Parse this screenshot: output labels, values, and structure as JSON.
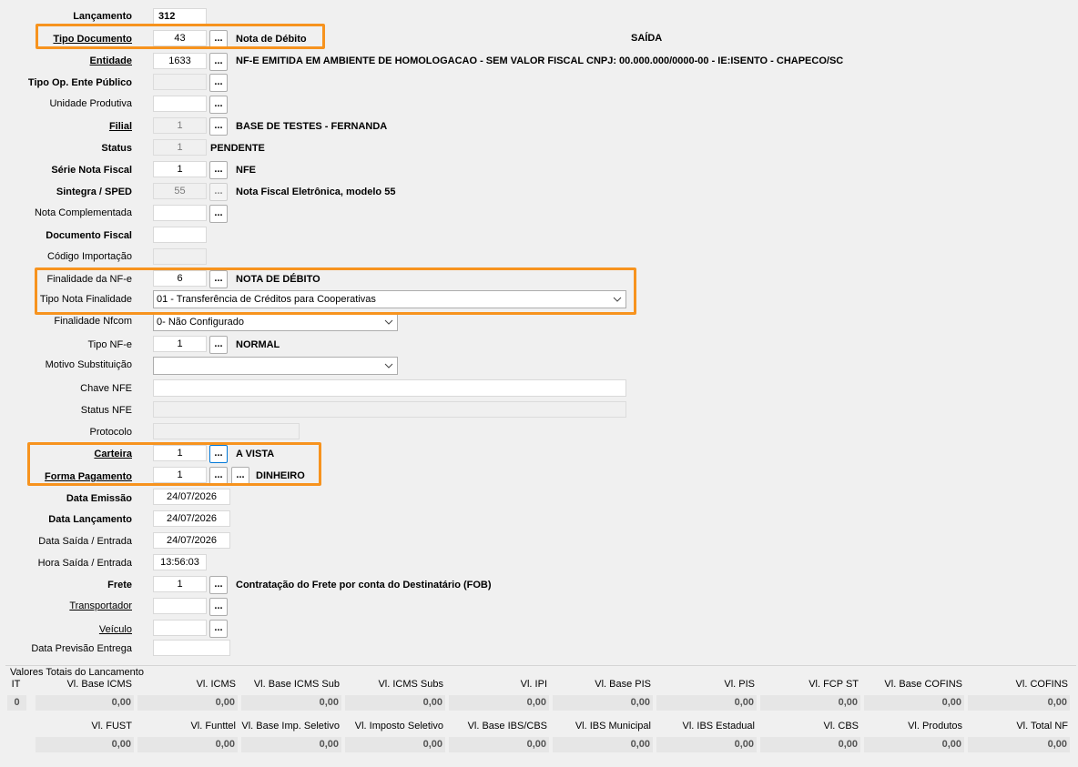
{
  "form": {
    "lancamento": {
      "label": "Lançamento",
      "value": "312"
    },
    "tipo_documento": {
      "label": "Tipo Documento",
      "value": "43",
      "desc": "Nota de Débito",
      "operacao": "SAÍDA"
    },
    "entidade": {
      "label": "Entidade",
      "value": "1633",
      "desc": "NF-E EMITIDA EM AMBIENTE DE HOMOLOGACAO - SEM VALOR FISCAL CNPJ: 00.000.000/0000-00 - IE:ISENTO - CHAPECO/SC"
    },
    "tipo_op_ente": {
      "label": "Tipo Op. Ente Público",
      "value": ""
    },
    "unidade_produtiva": {
      "label": "Unidade Produtiva",
      "value": ""
    },
    "filial": {
      "label": "Filial",
      "value": "1",
      "desc": "BASE DE TESTES - FERNANDA"
    },
    "status": {
      "label": "Status",
      "value": "1",
      "desc": "PENDENTE"
    },
    "serie": {
      "label": "Série Nota Fiscal",
      "value": "1",
      "desc": "NFE"
    },
    "sintegra": {
      "label": "Sintegra / SPED",
      "value": "55",
      "desc": "Nota Fiscal Eletrônica, modelo 55"
    },
    "nota_complementada": {
      "label": "Nota Complementada",
      "value": ""
    },
    "documento_fiscal": {
      "label": "Documento Fiscal",
      "value": ""
    },
    "codigo_importacao": {
      "label": "Código Importação",
      "value": ""
    },
    "finalidade_nfe": {
      "label": "Finalidade da NF-e",
      "value": "6",
      "desc": "NOTA DE DÉBITO"
    },
    "tipo_nota_finalidade": {
      "label": "Tipo Nota Finalidade",
      "value": "01 - Transferência de Créditos para Cooperativas"
    },
    "finalidade_nfcom": {
      "label": "Finalidade Nfcom",
      "value": "0- Não Configurado"
    },
    "tipo_nfe": {
      "label": "Tipo NF-e",
      "value": "1",
      "desc": "NORMAL"
    },
    "motivo_substituicao": {
      "label": "Motivo Substituição",
      "value": ""
    },
    "chave_nfe": {
      "label": "Chave NFE",
      "value": ""
    },
    "status_nfe": {
      "label": "Status NFE",
      "value": ""
    },
    "protocolo": {
      "label": "Protocolo",
      "value": ""
    },
    "carteira": {
      "label": "Carteira",
      "value": "1",
      "desc": "A VISTA"
    },
    "forma_pagamento": {
      "label": "Forma Pagamento",
      "value": "1",
      "desc": "DINHEIRO"
    },
    "data_emissao": {
      "label": "Data Emissão",
      "value": "24/07/2026"
    },
    "data_lancamento": {
      "label": "Data Lançamento",
      "value": "24/07/2026"
    },
    "data_saida": {
      "label": "Data Saída / Entrada",
      "value": "24/07/2026"
    },
    "hora_saida": {
      "label": "Hora Saída / Entrada",
      "value": "13:56:03"
    },
    "frete": {
      "label": "Frete",
      "value": "1",
      "desc": "Contratação do Frete por conta do Destinatário (FOB)"
    },
    "transportador": {
      "label": "Transportador",
      "value": ""
    },
    "veiculo": {
      "label": "Veículo",
      "value": ""
    },
    "data_previsao": {
      "label": "Data Previsão Entrega",
      "value": ""
    }
  },
  "browse_button": "...",
  "totals": {
    "title": "Valores Totais do Lancamento",
    "row1_headers": [
      "IT",
      "Vl. Base ICMS",
      "Vl. ICMS",
      "Vl. Base ICMS Sub",
      "Vl. ICMS Subs",
      "Vl. IPI",
      "Vl. Base PIS",
      "Vl. PIS",
      "Vl. FCP ST",
      "Vl. Base COFINS",
      "Vl. COFINS"
    ],
    "row1_values": [
      "0",
      "0,00",
      "0,00",
      "0,00",
      "0,00",
      "0,00",
      "0,00",
      "0,00",
      "0,00",
      "0,00",
      "0,00"
    ],
    "row2_headers": [
      "Vl. FUST",
      "Vl. Funttel",
      "Vl. Base Imp. Seletivo",
      "Vl. Imposto Seletivo",
      "Vl. Base IBS/CBS",
      "Vl. IBS Municipal",
      "Vl. IBS Estadual",
      "Vl. CBS",
      "Vl. Produtos",
      "Vl. Total NF"
    ],
    "row2_values": [
      "0,00",
      "0,00",
      "0,00",
      "0,00",
      "0,00",
      "0,00",
      "0,00",
      "0,00",
      "0,00",
      "0,00"
    ]
  },
  "colors": {
    "highlight": "#f7931e",
    "background": "#f0f0f0"
  }
}
